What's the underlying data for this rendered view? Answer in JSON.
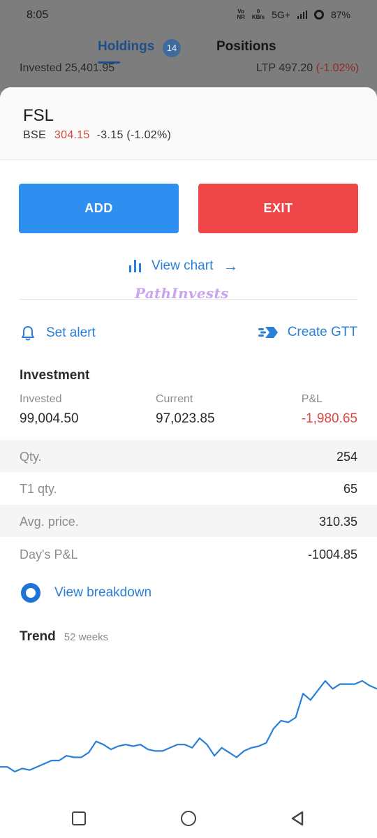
{
  "status_bar": {
    "time": "8:05",
    "network_vo": "Vo",
    "network_nr": "NR",
    "speed_value": "0",
    "speed_unit": "KB/s",
    "signal": "5G+",
    "battery": "87%"
  },
  "tabs": {
    "holdings_label": "Holdings",
    "holdings_count": "14",
    "positions_label": "Positions"
  },
  "background_row": {
    "invested_label": "Invested",
    "invested_value": "25,401.95",
    "ltp_label": "LTP",
    "ltp_value": "497.20",
    "ltp_change": "(-1.02%)"
  },
  "stock": {
    "symbol": "FSL",
    "exchange": "BSE",
    "ltp": "304.15",
    "change": "-3.15 (-1.02%)"
  },
  "actions": {
    "add_label": "ADD",
    "exit_label": "EXIT",
    "view_chart_label": "View chart",
    "set_alert_label": "Set alert",
    "create_gtt_label": "Create GTT"
  },
  "watermark": "PathInvests",
  "investment": {
    "title": "Investment",
    "invested_label": "Invested",
    "invested_value": "99,004.50",
    "current_label": "Current",
    "current_value": "97,023.85",
    "pnl_label": "P&L",
    "pnl_value": "-1,980.65"
  },
  "stats": [
    {
      "label": "Qty.",
      "value": "254"
    },
    {
      "label": "T1 qty.",
      "value": "65"
    },
    {
      "label": "Avg. price.",
      "value": "310.35"
    },
    {
      "label": "Day's P&L",
      "value": "-1004.85"
    }
  ],
  "breakdown_label": "View breakdown",
  "trend": {
    "title": "Trend",
    "period": "52 weeks"
  },
  "colors": {
    "accent": "#2a7fd8",
    "add": "#2f8ff0",
    "exit": "#ee4549",
    "negative": "#d9473f"
  },
  "chart_data": {
    "type": "line",
    "title": "",
    "xlabel": "",
    "ylabel": "",
    "grid": false,
    "series": [
      {
        "values": [
          6,
          6,
          3,
          5,
          4,
          6,
          8,
          10,
          10,
          13,
          12,
          12,
          15,
          22,
          20,
          17,
          19,
          20,
          19,
          20,
          17,
          16,
          16,
          18,
          20,
          20,
          18,
          24,
          20,
          13,
          18,
          15,
          12,
          16,
          18,
          19,
          21,
          30,
          35,
          34,
          37,
          52,
          48,
          54,
          60,
          55,
          58,
          58,
          58,
          60,
          57,
          55
        ]
      }
    ]
  }
}
